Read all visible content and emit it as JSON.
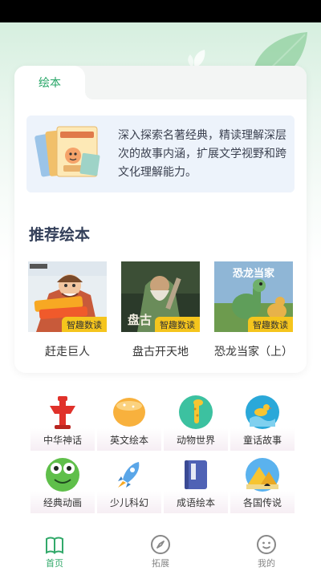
{
  "tabs": {
    "active": "绘本"
  },
  "intro": {
    "text": "深入探索名著经典，精读理解深层次的故事内涵，扩展文学视野和跨文化理解能力。"
  },
  "recommended": {
    "title": "推荐绘本",
    "badge": "智趣数读",
    "books": [
      {
        "title": "赶走巨人"
      },
      {
        "title": "盘古开天地",
        "cover_text": "盘古"
      },
      {
        "title": "恐龙当家（上）",
        "cover_text": "恐龙当家"
      }
    ]
  },
  "categories": [
    {
      "label": "中华神话",
      "icon": "red-pillar-icon"
    },
    {
      "label": "英文绘本",
      "icon": "orange-bowl-icon"
    },
    {
      "label": "动物世界",
      "icon": "giraffe-icon"
    },
    {
      "label": "童话故事",
      "icon": "duck-waves-icon"
    },
    {
      "label": "经典动画",
      "icon": "frog-icon"
    },
    {
      "label": "少儿科幻",
      "icon": "rocket-icon"
    },
    {
      "label": "成语绘本",
      "icon": "book-icon"
    },
    {
      "label": "各国传说",
      "icon": "pyramid-icon"
    }
  ],
  "bottom_nav": [
    {
      "label": "首页",
      "icon": "home-book-icon",
      "active": true
    },
    {
      "label": "拓展",
      "icon": "compass-icon",
      "active": false
    },
    {
      "label": "我的",
      "icon": "smiley-icon",
      "active": false
    }
  ],
  "colors": {
    "accent": "#32a96a",
    "badge": "#f5c51d",
    "title": "#34405a",
    "intro_bg": "#edf3fb"
  }
}
